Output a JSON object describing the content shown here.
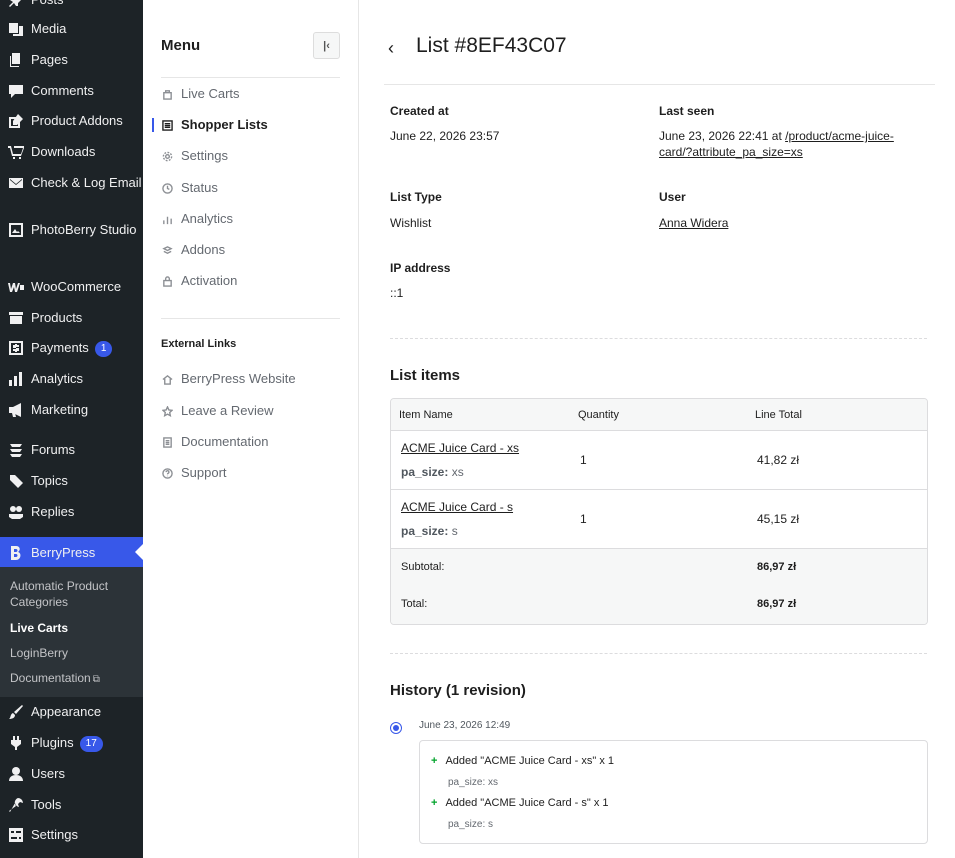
{
  "wp_menu": {
    "posts": "Posts",
    "media": "Media",
    "pages": "Pages",
    "comments": "Comments",
    "product_addons": "Product Addons",
    "downloads": "Downloads",
    "check_log_email": "Check & Log Email",
    "photoberry": "PhotoBerry Studio",
    "woocommerce": "WooCommerce",
    "products": "Products",
    "payments": "Payments",
    "payments_badge": "1",
    "analytics": "Analytics",
    "marketing": "Marketing",
    "forums": "Forums",
    "topics": "Topics",
    "replies": "Replies",
    "berrypress": "BerryPress",
    "appearance": "Appearance",
    "plugins": "Plugins",
    "plugins_badge": "17",
    "users": "Users",
    "tools": "Tools",
    "settings": "Settings",
    "submenu": {
      "auto_categories": "Automatic Product Categories",
      "live_carts": "Live Carts",
      "loginberry": "LoginBerry",
      "documentation": "Documentation"
    }
  },
  "menu": {
    "title": "Menu",
    "collapse_icon": "collapse-left-icon",
    "items": [
      {
        "label": "Live Carts",
        "icon": "cart-icon"
      },
      {
        "label": "Shopper Lists",
        "icon": "list-icon",
        "active": true
      },
      {
        "label": "Settings",
        "icon": "gear-icon"
      },
      {
        "label": "Status",
        "icon": "status-icon"
      },
      {
        "label": "Analytics",
        "icon": "bar-chart-icon"
      },
      {
        "label": "Addons",
        "icon": "addons-icon"
      },
      {
        "label": "Activation",
        "icon": "lock-icon"
      }
    ],
    "external_title": "External Links",
    "external": [
      {
        "label": "BerryPress Website",
        "icon": "home-icon"
      },
      {
        "label": "Leave a Review",
        "icon": "star-icon"
      },
      {
        "label": "Documentation",
        "icon": "doc-icon"
      },
      {
        "label": "Support",
        "icon": "help-icon"
      }
    ]
  },
  "page": {
    "title": "List #8EF43C07",
    "fields": {
      "created_at_label": "Created at",
      "created_at": "June 22, 2026 23:57",
      "last_seen_label": "Last seen",
      "last_seen_prefix": "June 23, 2026 22:41 at",
      "last_seen_link": "/product/acme-juice-card/?attribute_pa_size=xs",
      "list_type_label": "List Type",
      "list_type": "Wishlist",
      "user_label": "User",
      "user": "Anna Widera",
      "ip_label": "IP address",
      "ip": "::1"
    },
    "items_title": "List items",
    "table": {
      "headers": [
        "Item Name",
        "Quantity",
        "Line Total"
      ],
      "rows": [
        {
          "name": "ACME Juice Card - xs",
          "meta_key": "pa_size:",
          "meta_value": "xs",
          "qty": "1",
          "total": "41,82 zł"
        },
        {
          "name": "ACME Juice Card - s",
          "meta_key": "pa_size:",
          "meta_value": "s",
          "qty": "1",
          "total": "45,15 zł"
        }
      ],
      "subtotal_label": "Subtotal:",
      "subtotal": "86,97 zł",
      "total_label": "Total:",
      "total": "86,97 zł"
    },
    "history_title": "History (1 revision)",
    "revision": {
      "date": "June 23, 2026 12:49",
      "changes": [
        {
          "text": "Added \"ACME Juice Card - xs\" x 1",
          "meta_key": "pa_size:",
          "meta_value": "xs"
        },
        {
          "text": "Added \"ACME Juice Card - s\" x 1",
          "meta_key": "pa_size:",
          "meta_value": "s"
        }
      ]
    }
  }
}
